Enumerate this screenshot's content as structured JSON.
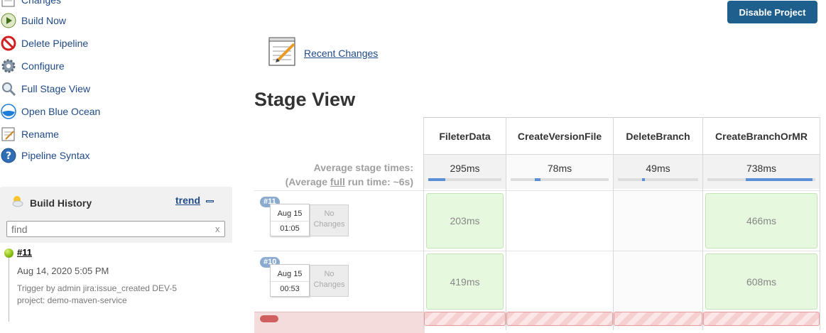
{
  "sidebar": {
    "items": [
      {
        "label": "Changes",
        "icon": "notepad-icon"
      },
      {
        "label": "Build Now",
        "icon": "build-now-icon"
      },
      {
        "label": "Delete Pipeline",
        "icon": "no-entry-icon"
      },
      {
        "label": "Configure",
        "icon": "gear-icon"
      },
      {
        "label": "Full Stage View",
        "icon": "magnifier-icon"
      },
      {
        "label": "Open Blue Ocean",
        "icon": "blue-ocean-icon"
      },
      {
        "label": "Rename",
        "icon": "notepad-icon"
      },
      {
        "label": "Pipeline Syntax",
        "icon": "help-icon"
      }
    ]
  },
  "build_history": {
    "title": "Build History",
    "trend_label": "trend",
    "search_placeholder": "find",
    "search_clear": "x",
    "builds": [
      {
        "number": "#11",
        "date": "Aug 14, 2020 5:05 PM",
        "trigger_line1": "Trigger by admin jira:issue_created DEV-5",
        "trigger_line2": "project: demo-maven-service"
      }
    ]
  },
  "header": {
    "disable_button": "Disable Project",
    "recent_changes": "Recent Changes",
    "stage_view_title": "Stage View"
  },
  "stage_view": {
    "avg_stage_label": "Average stage times:",
    "avg_run_prefix": "(Average ",
    "avg_run_full": "full",
    "avg_run_suffix": " run time: ~6s)",
    "stages": [
      {
        "name": "FileterData",
        "avg": "295ms"
      },
      {
        "name": "CreateVersionFile",
        "avg": "78ms"
      },
      {
        "name": "DeleteBranch",
        "avg": "49ms"
      },
      {
        "name": "CreateBranchOrMR",
        "avg": "738ms"
      }
    ],
    "runs": [
      {
        "badge": "#11",
        "date": "Aug 15",
        "time": "01:05",
        "changes": "No Changes",
        "cells": [
          "203ms",
          "",
          "",
          "466ms"
        ]
      },
      {
        "badge": "#10",
        "date": "Aug 15",
        "time": "00:53",
        "changes": "No Changes",
        "cells": [
          "419ms",
          "",
          "",
          "608ms"
        ]
      }
    ],
    "colors": {
      "success": "#e6f8de",
      "fail": "#f6d0d0",
      "progress": "#5b8fd6"
    }
  }
}
